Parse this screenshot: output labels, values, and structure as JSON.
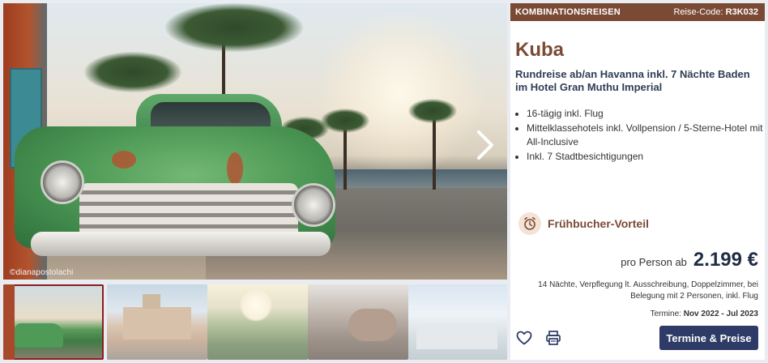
{
  "hero": {
    "credit": "©dianapostolachi",
    "next_icon": "chevron-right-icon"
  },
  "thumbnails": [
    {
      "subject": "green-vintage-car",
      "active": true
    },
    {
      "subject": "havana-building",
      "active": false
    },
    {
      "subject": "tobacco-field-sunrise",
      "active": false
    },
    {
      "subject": "hands-cigar",
      "active": false
    },
    {
      "subject": "city-view",
      "active": false
    }
  ],
  "panel": {
    "category": "KOMBINATIONSREISEN",
    "code_label": "Reise-Code:",
    "code_value": "R3K032",
    "title": "Kuba",
    "subtitle": "Rundreise ab/an Havanna inkl. 7 Nächte Baden im Hotel Gran Muthu Imperial",
    "features": [
      "16-tägig inkl. Flug",
      "Mittelklassehotels inkl. Vollpension / 5-Sterne-Hotel mit All-Inclusive",
      "Inkl. 7 Stadtbesichtigungen"
    ],
    "badge": {
      "icon": "alarm-clock-icon",
      "label": "Frühbucher-Vorteil"
    },
    "price_prefix": "pro Person ab",
    "price": "2.199 €",
    "details": "14 Nächte, Verpflegung lt. Ausschreibung, Doppelzimmer, bei Belegung mit 2 Personen, inkl. Flug",
    "dates_label": "Termine:",
    "dates_value": "Nov 2022 - Jul 2023",
    "cta_label": "Termine & Preise"
  },
  "colors": {
    "brand_brown": "#7a4a35",
    "navy": "#2d3b66",
    "active_thumb_border": "#8b1d1d"
  }
}
